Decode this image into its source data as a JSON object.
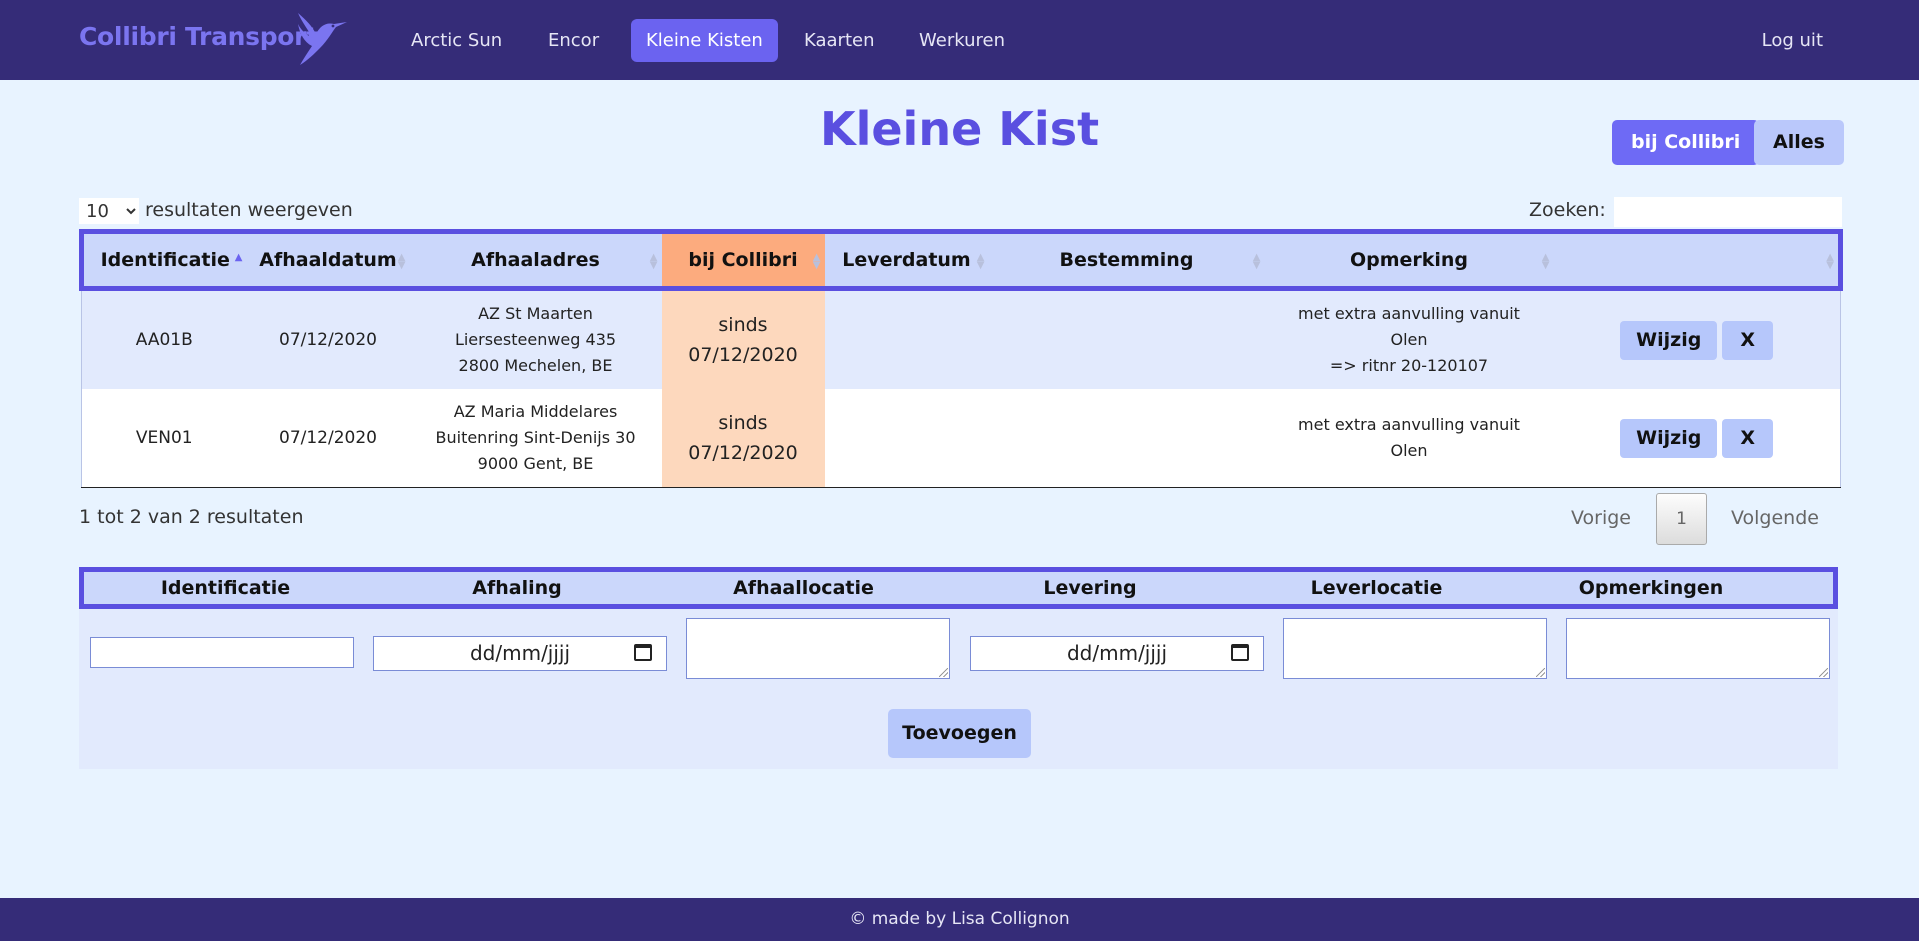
{
  "navbar": {
    "brand": "Collibri Transport",
    "items": [
      {
        "label": "Arctic Sun",
        "active": false
      },
      {
        "label": "Encor",
        "active": false
      },
      {
        "label": "Kleine Kisten",
        "active": true
      },
      {
        "label": "Kaarten",
        "active": false
      },
      {
        "label": "Werkuren",
        "active": false
      }
    ],
    "logout": "Log uit",
    "brand_color": "#7b75f0",
    "bg_color": "#352c78"
  },
  "page": {
    "title": "Kleine Kist",
    "filter_buttons": [
      "bij Collibri",
      "Alles"
    ]
  },
  "table": {
    "length_value": "10",
    "length_label": "resultaten weergeven",
    "search_label": "Zoeken:",
    "columns": [
      "Identificatie",
      "Afhaaldatum",
      "Afhaaladres",
      "bij Collibri",
      "Leverdatum",
      "Bestemming",
      "Opmerking",
      ""
    ],
    "rows": [
      {
        "id": "AA01B",
        "date": "07/12/2020",
        "addr1": "AZ St Maarten",
        "addr2": "Liersesteenweg 435",
        "addr3": "2800 Mechelen, BE",
        "bij1": "sinds",
        "bij2": "07/12/2020",
        "leverdatum": "",
        "bestemming": "",
        "opm1": "met extra aanvulling vanuit",
        "opm2": "Olen",
        "opm3": "=> ritnr 20-120107",
        "edit": "Wijzig",
        "del": "X"
      },
      {
        "id": "VEN01",
        "date": "07/12/2020",
        "addr1": "AZ Maria Middelares",
        "addr2": "Buitenring Sint-Denijs 30",
        "addr3": "9000 Gent, BE",
        "bij1": "sinds",
        "bij2": "07/12/2020",
        "leverdatum": "",
        "bestemming": "",
        "opm1": "met extra aanvulling vanuit",
        "opm2": "Olen",
        "opm3": "",
        "edit": "Wijzig",
        "del": "X"
      }
    ],
    "info": "1 tot 2 van 2 resultaten",
    "prev": "Vorige",
    "page": "1",
    "next": "Volgende"
  },
  "add_form": {
    "columns": [
      "Identificatie",
      "Afhaling",
      "Afhaallocatie",
      "Levering",
      "Leverlocatie",
      "Opmerkingen"
    ],
    "date_placeholder": "dd/mm/jjjj",
    "submit": "Toevoegen"
  },
  "footer": "© made by Lisa Collignon",
  "colors": {
    "accent": "#5a4fe0",
    "highlight_header": "#fcab7e",
    "highlight_cell": "#fdd8bd",
    "button": "#b6c7fb"
  },
  "icons": [
    "hummingbird-logo-icon",
    "sort-asc-icon",
    "sort-both-icon",
    "calendar-icon",
    "chevron-down-icon"
  ]
}
